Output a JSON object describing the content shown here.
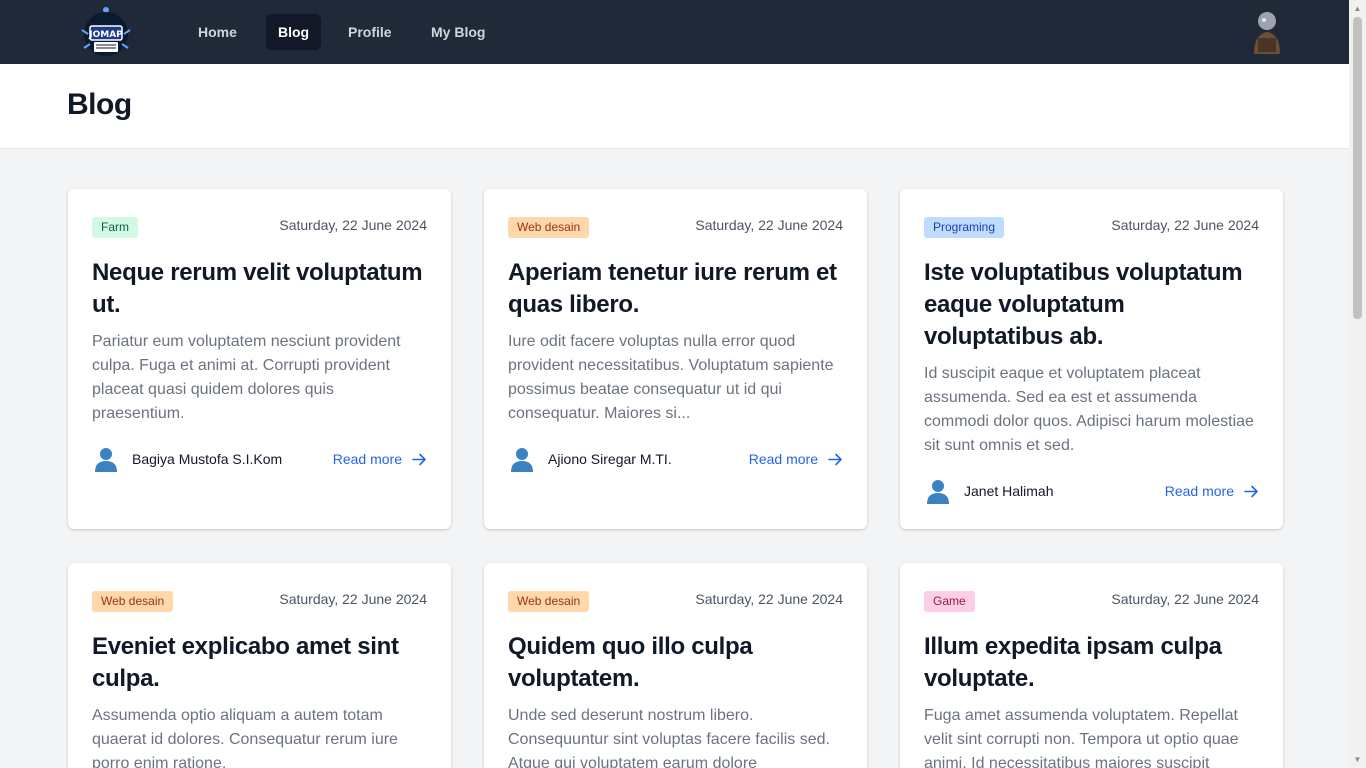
{
  "nav": {
    "logo_icon": "jomap-logo",
    "links": [
      {
        "label": "Home",
        "active": false
      },
      {
        "label": "Blog",
        "active": true
      },
      {
        "label": "Profile",
        "active": false
      },
      {
        "label": "My Blog",
        "active": false
      }
    ],
    "avatar_icon": "user-avatar"
  },
  "page": {
    "title": "Blog"
  },
  "colors": {
    "nav_bg": "#1f2937",
    "accent_link": "#2563eb",
    "badge_farm_bg": "#d1fae5",
    "badge_farm_fg": "#065f46",
    "badge_web_bg": "#fed7aa",
    "badge_web_fg": "#9a3412",
    "badge_prog_bg": "#bfdbfe",
    "badge_prog_fg": "#1e40af",
    "badge_game_bg": "#fbcfe8",
    "badge_game_fg": "#9d174d"
  },
  "posts": [
    {
      "category": "Farm",
      "date": "Saturday, 22 June 2024",
      "title": "Neque rerum velit voluptatum ut.",
      "excerpt": "Pariatur eum voluptatem nesciunt provident culpa. Fuga et animi at. Corrupti provident placeat quasi quidem dolores quis praesentium.",
      "author": "Bagiya Mustofa S.I.Kom",
      "read_more": "Read more"
    },
    {
      "category": "Web desain",
      "date": "Saturday, 22 June 2024",
      "title": "Aperiam tenetur iure rerum et quas libero.",
      "excerpt": "Iure odit facere voluptas nulla error quod provident necessitatibus. Voluptatum sapiente possimus beatae consequatur ut id qui consequatur. Maiores si...",
      "author": "Ajiono Siregar M.TI.",
      "read_more": "Read more"
    },
    {
      "category": "Programing",
      "date": "Saturday, 22 June 2024",
      "title": "Iste voluptatibus voluptatum eaque voluptatum voluptatibus ab.",
      "excerpt": "Id suscipit eaque et voluptatem placeat assumenda. Sed ea est et assumenda commodi dolor quos. Adipisci harum molestiae sit sunt omnis et sed.",
      "author": "Janet Halimah",
      "read_more": "Read more"
    },
    {
      "category": "Web desain",
      "date": "Saturday, 22 June 2024",
      "title": "Eveniet explicabo amet sint culpa.",
      "excerpt": "Assumenda optio aliquam a autem totam quaerat id dolores. Consequatur rerum iure porro enim ratione.",
      "author": "",
      "read_more": ""
    },
    {
      "category": "Web desain",
      "date": "Saturday, 22 June 2024",
      "title": "Quidem quo illo culpa voluptatem.",
      "excerpt": "Unde sed deserunt nostrum libero. Consequuntur sint voluptas facere facilis sed. Atque qui voluptatem earum dolore",
      "author": "",
      "read_more": ""
    },
    {
      "category": "Game",
      "date": "Saturday, 22 June 2024",
      "title": "Illum expedita ipsam culpa voluptate.",
      "excerpt": "Fuga amet assumenda voluptatem. Repellat velit sint corrupti non. Tempora ut optio quae animi. Id necessitatibus maiores suscipit",
      "author": "",
      "read_more": ""
    }
  ]
}
